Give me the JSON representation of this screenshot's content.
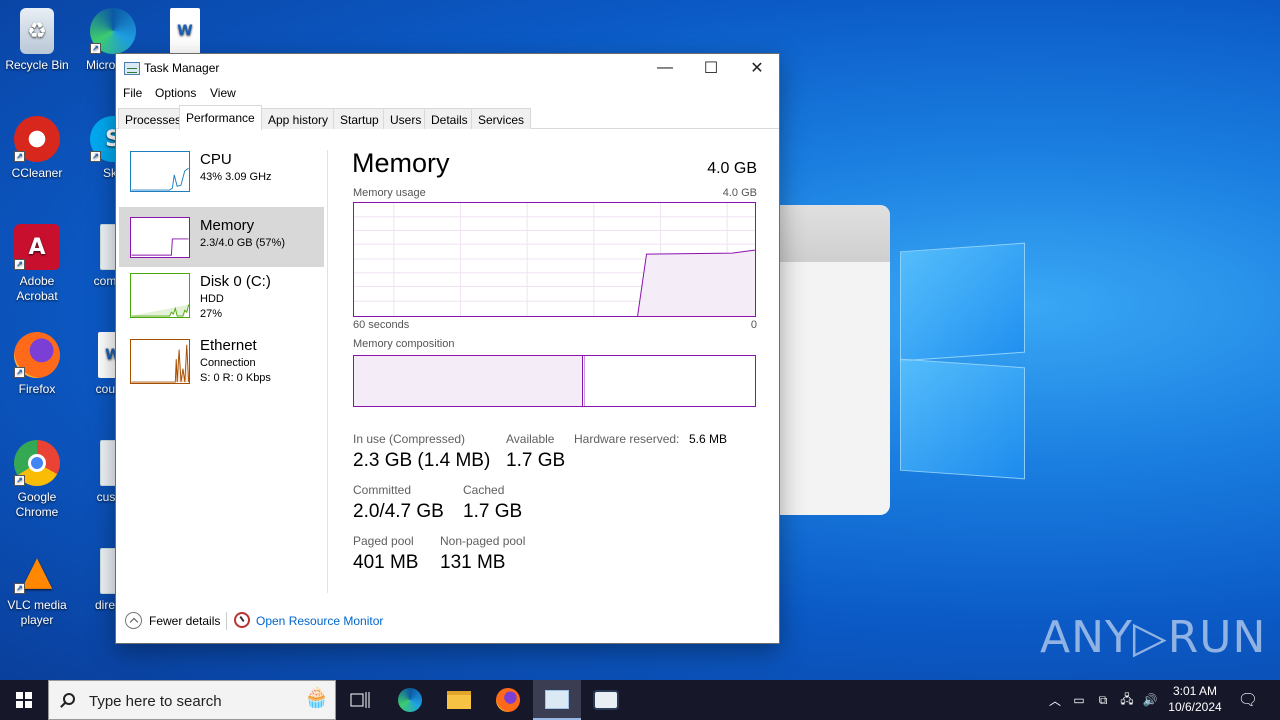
{
  "desktop": {
    "icons": [
      {
        "label": "Recycle Bin"
      },
      {
        "label": "Micro Edg"
      },
      {
        "label": ""
      },
      {
        "label": "CCleaner"
      },
      {
        "label": "Sky"
      },
      {
        "label": "Adobe Acrobat"
      },
      {
        "label": "comple"
      },
      {
        "label": "Firefox"
      },
      {
        "label": "counci"
      },
      {
        "label": "Google Chrome"
      },
      {
        "label": "custor"
      },
      {
        "label": "VLC media player"
      },
      {
        "label": "directo"
      }
    ],
    "watermark": "ANY▷RUN"
  },
  "window": {
    "title": "Task Manager",
    "minimize_glyph": "—",
    "maximize_glyph": "☐",
    "close_glyph": "✕"
  },
  "menu": [
    "File",
    "Options",
    "View"
  ],
  "tabs": [
    "Processes",
    "Performance",
    "App history",
    "Startup",
    "Users",
    "Details",
    "Services"
  ],
  "active_tab": "Performance",
  "sidebar": [
    {
      "name": "CPU",
      "line1": "43%  3.09 GHz",
      "line2": "",
      "color": "#1e7fc0"
    },
    {
      "name": "Memory",
      "line1": "2.3/4.0 GB (57%)",
      "line2": "",
      "color": "#8b12ae"
    },
    {
      "name": "Disk 0 (C:)",
      "line1": "HDD",
      "line2": "27%",
      "color": "#4da60c"
    },
    {
      "name": "Ethernet",
      "line1": "Connection",
      "line2": "S: 0  R: 0 Kbps",
      "color": "#a74f01"
    }
  ],
  "memory": {
    "title": "Memory",
    "total": "4.0 GB",
    "usage_label": "Memory usage",
    "usage_max": "4.0 GB",
    "time_left": "60 seconds",
    "time_right": "0",
    "composition_label": "Memory composition",
    "in_use_fraction": 0.57,
    "stats": {
      "in_use_label": "In use (Compressed)",
      "in_use_value": "2.3 GB (1.4 MB)",
      "available_label": "Available",
      "available_value": "1.7 GB",
      "hw_reserved_label": "Hardware reserved:",
      "hw_reserved_value": "5.6 MB",
      "committed_label": "Committed",
      "committed_value": "2.0/4.7 GB",
      "cached_label": "Cached",
      "cached_value": "1.7 GB",
      "paged_label": "Paged pool",
      "paged_value": "401 MB",
      "nonpaged_label": "Non-paged pool",
      "nonpaged_value": "131 MB"
    },
    "accent_color": "#8b12ae"
  },
  "footer": {
    "fewer_details": "Fewer details",
    "open_resource_monitor": "Open Resource Monitor"
  },
  "taskbar": {
    "search_placeholder": "Type here to search",
    "time": "3:01 AM",
    "date": "10/6/2024"
  }
}
